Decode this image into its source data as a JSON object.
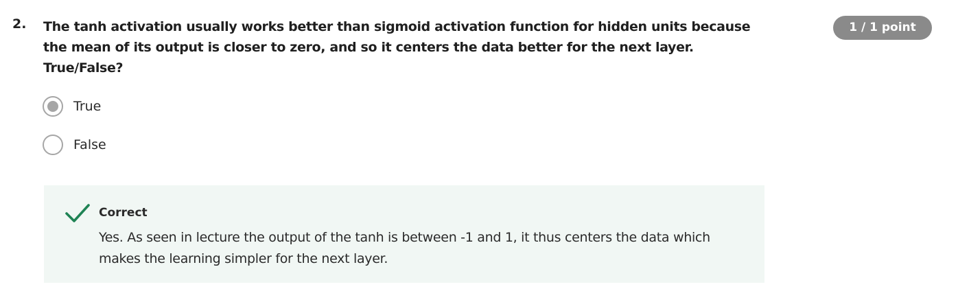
{
  "question": {
    "number": "2.",
    "lines": [
      "The tanh activation usually works better than sigmoid activation function for hidden units because",
      "the mean of its output is closer to zero, and so it centers the data better for the next layer.",
      "True/False?"
    ]
  },
  "score": {
    "label": "1 / 1 point"
  },
  "options": [
    {
      "label": "True",
      "selected": true
    },
    {
      "label": "False",
      "selected": false
    }
  ],
  "feedback": {
    "title": "Correct",
    "icon": "checkmark-icon",
    "lines": [
      "Yes. As seen in lecture the output of the tanh is between -1 and 1, it thus centers the data which",
      "makes the learning simpler for the next layer."
    ]
  },
  "colors": {
    "badge_bg": "#8a8a8a",
    "radio_gray": "#a6a6a6",
    "feedback_bg": "#f1f7f4",
    "check_green": "#1f8354"
  }
}
